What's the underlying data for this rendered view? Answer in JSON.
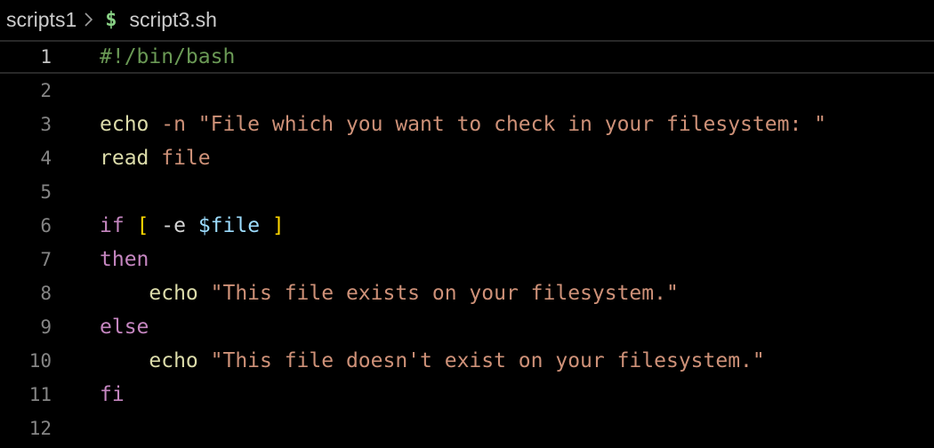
{
  "breadcrumb": {
    "folder": "scripts1",
    "file_icon_glyph": "$",
    "file": "script3.sh"
  },
  "colors": {
    "background": "#000000",
    "comment": "#6a9955",
    "function": "#dcdcaa",
    "string": "#ce9178",
    "keyword": "#c586c0",
    "bracket": "#ffd700",
    "variable": "#9cdcfe"
  },
  "editor": {
    "current_line": 1,
    "lines": [
      {
        "number": "1",
        "tokens": [
          {
            "t": "#!/bin/bash",
            "c": "comment"
          }
        ]
      },
      {
        "number": "2",
        "tokens": []
      },
      {
        "number": "3",
        "tokens": [
          {
            "t": "echo",
            "c": "func"
          },
          {
            "t": " -n \"File which you want to check in your filesystem: \"",
            "c": "str"
          }
        ]
      },
      {
        "number": "4",
        "tokens": [
          {
            "t": "read",
            "c": "func"
          },
          {
            "t": " file",
            "c": "str"
          }
        ]
      },
      {
        "number": "5",
        "tokens": []
      },
      {
        "number": "6",
        "tokens": [
          {
            "t": "if",
            "c": "kw"
          },
          {
            "t": " ",
            "c": "op"
          },
          {
            "t": "[",
            "c": "bracket"
          },
          {
            "t": " -e ",
            "c": "op"
          },
          {
            "t": "$file",
            "c": "var"
          },
          {
            "t": " ",
            "c": "op"
          },
          {
            "t": "]",
            "c": "bracket"
          }
        ]
      },
      {
        "number": "7",
        "tokens": [
          {
            "t": "then",
            "c": "kw"
          }
        ]
      },
      {
        "number": "8",
        "tokens": [
          {
            "t": "    ",
            "c": "op"
          },
          {
            "t": "echo",
            "c": "func"
          },
          {
            "t": " \"This file exists on your filesystem.\"",
            "c": "str"
          }
        ]
      },
      {
        "number": "9",
        "tokens": [
          {
            "t": "else",
            "c": "kw"
          }
        ]
      },
      {
        "number": "10",
        "tokens": [
          {
            "t": "    ",
            "c": "op"
          },
          {
            "t": "echo",
            "c": "func"
          },
          {
            "t": " \"This file doesn't exist on your filesystem.\"",
            "c": "str"
          }
        ]
      },
      {
        "number": "11",
        "tokens": [
          {
            "t": "fi",
            "c": "kw"
          }
        ]
      },
      {
        "number": "12",
        "tokens": []
      }
    ]
  }
}
